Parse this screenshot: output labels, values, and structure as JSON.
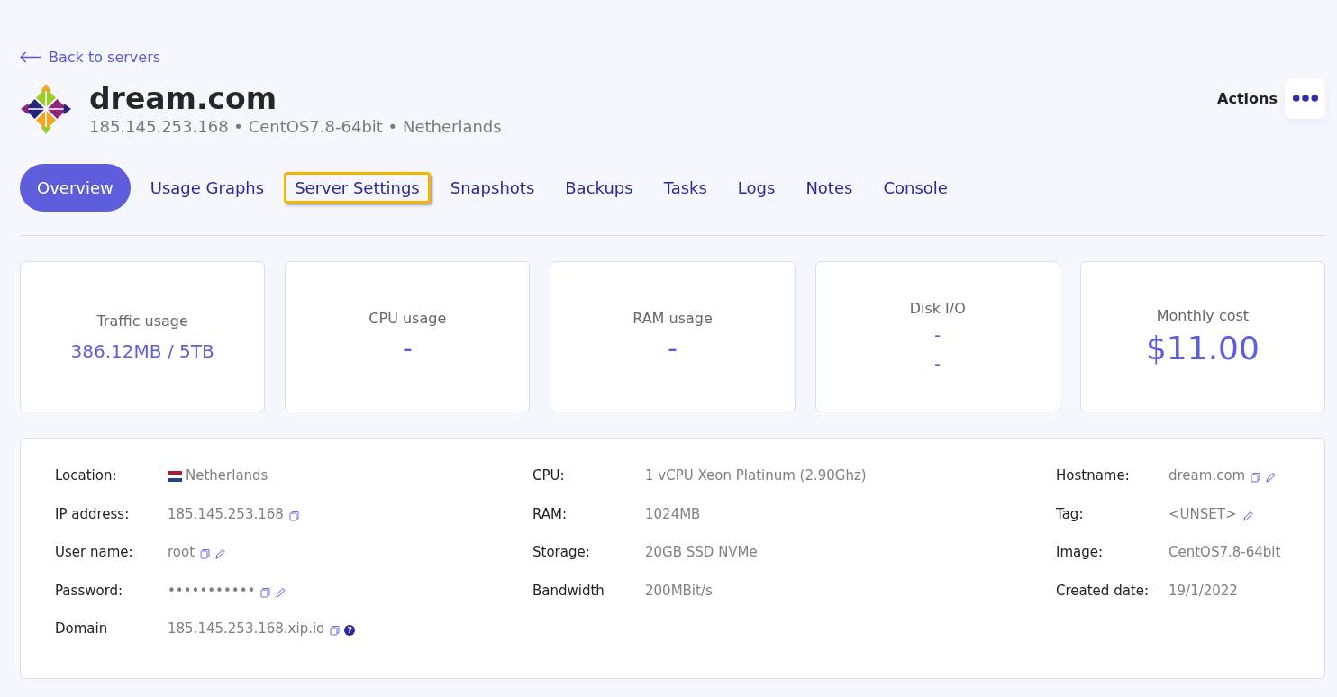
{
  "back_link": "Back to servers",
  "server": {
    "name": "dream.com",
    "subtitle": "185.145.253.168 • CentOS7.8-64bit • Netherlands"
  },
  "actions": {
    "label": "Actions"
  },
  "tabs": [
    {
      "label": "Overview",
      "selected": true,
      "highlighted": false
    },
    {
      "label": "Usage Graphs",
      "selected": false,
      "highlighted": false
    },
    {
      "label": "Server Settings",
      "selected": false,
      "highlighted": true
    },
    {
      "label": "Snapshots",
      "selected": false,
      "highlighted": false
    },
    {
      "label": "Backups",
      "selected": false,
      "highlighted": false
    },
    {
      "label": "Tasks",
      "selected": false,
      "highlighted": false
    },
    {
      "label": "Logs",
      "selected": false,
      "highlighted": false
    },
    {
      "label": "Notes",
      "selected": false,
      "highlighted": false
    },
    {
      "label": "Console",
      "selected": false,
      "highlighted": false
    }
  ],
  "stats": [
    {
      "title": "Traffic usage",
      "values": [
        "386.12MB / 5TB"
      ],
      "kind": "text"
    },
    {
      "title": "CPU usage",
      "values": [
        "-"
      ],
      "kind": "dash"
    },
    {
      "title": "RAM usage",
      "values": [
        "-"
      ],
      "kind": "dash"
    },
    {
      "title": "Disk I/O",
      "values": [
        "-",
        "-"
      ],
      "kind": "small"
    },
    {
      "title": "Monthly cost",
      "values": [
        "$11.00"
      ],
      "kind": "big"
    }
  ],
  "details": [
    [
      {
        "label": "Location:",
        "value": "Netherlands",
        "flag": true,
        "copy": false,
        "edit": false,
        "help": false
      },
      {
        "label": "IP address:",
        "value": "185.145.253.168",
        "flag": false,
        "copy": true,
        "edit": false,
        "help": false
      },
      {
        "label": "User name:",
        "value": "root",
        "flag": false,
        "copy": true,
        "edit": true,
        "help": false
      },
      {
        "label": "Password:",
        "value": "•••••••••••",
        "flag": false,
        "copy": true,
        "edit": true,
        "help": false
      },
      {
        "label": "Domain",
        "value": "185.145.253.168.xip.io",
        "flag": false,
        "copy": true,
        "edit": false,
        "help": "?"
      }
    ],
    [
      {
        "label": "CPU:",
        "value": "1 vCPU Xeon Platinum (2.90Ghz)",
        "flag": false,
        "copy": false,
        "edit": false,
        "help": false
      },
      {
        "label": "RAM:",
        "value": "1024MB",
        "flag": false,
        "copy": false,
        "edit": false,
        "help": false
      },
      {
        "label": "Storage:",
        "value": "20GB SSD NVMe",
        "flag": false,
        "copy": false,
        "edit": false,
        "help": false
      },
      {
        "label": "Bandwidth",
        "value": "200MBit/s",
        "flag": false,
        "copy": false,
        "edit": false,
        "help": false
      }
    ],
    [
      {
        "label": "Hostname:",
        "value": "dream.com",
        "flag": false,
        "copy": true,
        "edit": true,
        "help": false
      },
      {
        "label": "Tag:",
        "value": "<UNSET>",
        "flag": false,
        "copy": false,
        "edit": true,
        "help": false
      },
      {
        "label": "Image:",
        "value": "CentOS7.8-64bit",
        "flag": false,
        "copy": false,
        "edit": false,
        "help": false
      },
      {
        "label": "Created date:",
        "value": "19/1/2022",
        "flag": false,
        "copy": false,
        "edit": false,
        "help": false
      }
    ]
  ]
}
